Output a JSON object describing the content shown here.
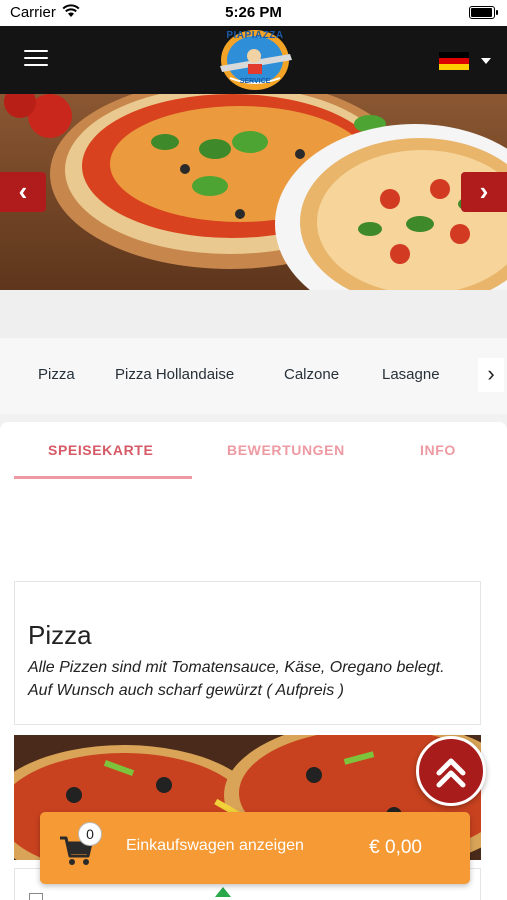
{
  "status_bar": {
    "carrier": "Carrier",
    "time": "5:26 PM",
    "battery_level": 1.0
  },
  "header": {
    "logo_text": "PIAPIAZZA",
    "logo_subtext": "SERVICE",
    "language": "de"
  },
  "categories": [
    "Pizza",
    "Pizza Hollandaise",
    "Calzone",
    "Lasagne"
  ],
  "tabs": [
    "SPEISEKARTE",
    "BEWERTUNGEN",
    "INFO"
  ],
  "active_tab": "SPEISEKARTE",
  "section": {
    "title": "Pizza",
    "description": "Alle Pizzen sind mit Tomatensauce, Käse, Oregano belegt. Auf Wunsch auch scharf gewürzt ( Aufpreis )"
  },
  "cart": {
    "count": "0",
    "label": "Einkaufswagen anzeigen",
    "total": "€ 0,00"
  },
  "colors": {
    "header_bg": "#141414",
    "accent_red": "#b01c1c",
    "tab_active": "#d65a66",
    "tab_inactive": "#ee9aa2",
    "cart_orange": "#f59a35"
  },
  "icons": [
    "wifi-icon",
    "battery-icon",
    "menu-icon",
    "german-flag-icon",
    "chevron-down-icon",
    "chevron-left-icon",
    "chevron-right-icon",
    "double-chevron-up-icon",
    "shopping-cart-icon"
  ]
}
